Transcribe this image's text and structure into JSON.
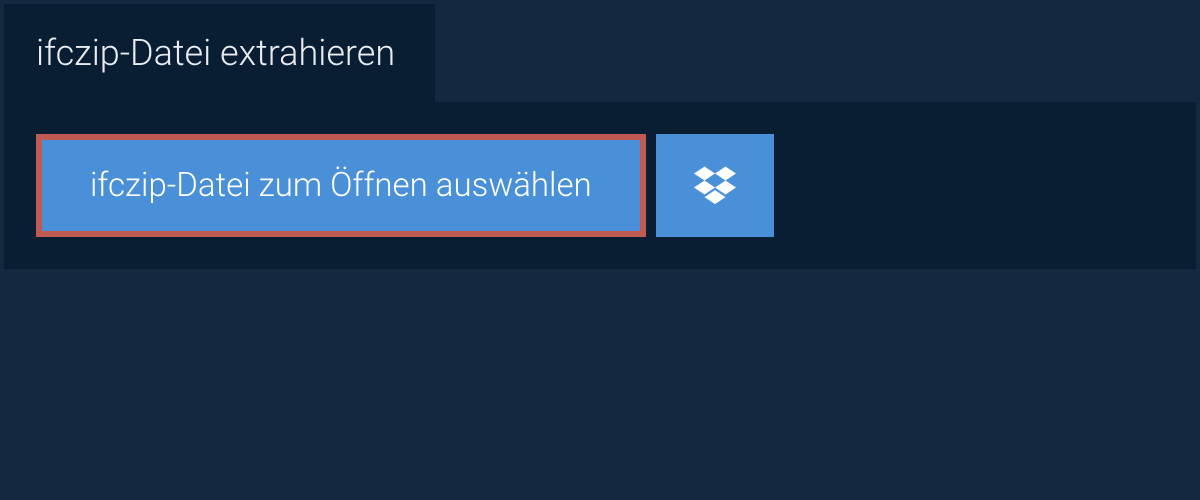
{
  "header": {
    "title": "ifczip-Datei extrahieren"
  },
  "actions": {
    "select_file_label": "ifczip-Datei zum Öffnen auswählen",
    "dropbox_icon": "dropbox"
  },
  "colors": {
    "background": "#12293f",
    "panel": "#0a1e33",
    "button": "#4a90d9",
    "highlight_border": "#c15a53",
    "text_light": "#e8edf2",
    "text_white": "#ffffff"
  }
}
